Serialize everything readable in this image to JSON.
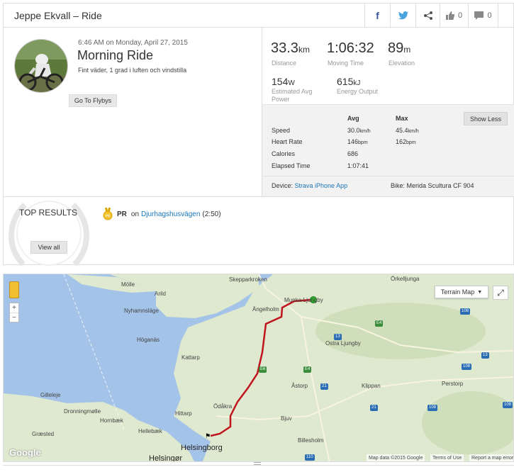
{
  "header": {
    "title": "Jeppe Ekvall – Ride",
    "likes": "0",
    "comments": "0"
  },
  "activity": {
    "date": "6:46 AM on Monday, April 27, 2015",
    "name": "Morning Ride",
    "description": "Fint väder, 1 grad i luften och vindstilla",
    "flyby_label": "Go To Flybys"
  },
  "stats": {
    "distance": {
      "value": "33.3",
      "unit": "km",
      "label": "Distance"
    },
    "moving_time": {
      "value": "1:06:32",
      "label": "Moving Time"
    },
    "elevation": {
      "value": "89",
      "unit": "m",
      "label": "Elevation"
    },
    "power": {
      "value": "154",
      "unit": "W",
      "label": "Estimated Avg Power"
    },
    "energy": {
      "value": "615",
      "unit": "kJ",
      "label": "Energy Output"
    },
    "show_less_label": "Show Less",
    "col_avg": "Avg",
    "col_max": "Max",
    "rows": [
      {
        "label": "Speed",
        "avg": "30.0",
        "avg_unit": "km/h",
        "max": "45.4",
        "max_unit": "km/h"
      },
      {
        "label": "Heart Rate",
        "avg": "146",
        "avg_unit": "bpm",
        "max": "162",
        "max_unit": "bpm"
      },
      {
        "label": "Calories",
        "avg": "686",
        "avg_unit": "",
        "max": "",
        "max_unit": ""
      },
      {
        "label": "Elapsed Time",
        "avg": "1:07:41",
        "avg_unit": "",
        "max": "",
        "max_unit": ""
      }
    ],
    "device_label": "Device:",
    "device_value": "Strava iPhone App",
    "bike": "Bike: Merida Scultura CF 904"
  },
  "results": {
    "heading": "TOP RESULTS",
    "view_all": "View all",
    "pr_badge": "PR",
    "pr_on": "on",
    "segment": "Djurhagshusvägen",
    "time": "(2:50)"
  },
  "map": {
    "type_label": "Terrain Map",
    "labels": [
      "Skepparkroken",
      "Mölle",
      "Arild",
      "Nyhamnsläge",
      "Ängelholm",
      "Munka-Ljungby",
      "Örkelljunga",
      "Höganäs",
      "Kattarp",
      "Ostra Ljungby",
      "Åstorp",
      "Klippan",
      "Perstorp",
      "Ödåkra",
      "Hittarp",
      "Bjuv",
      "Billesholm",
      "Gilleleje",
      "Dronningmølle",
      "Hornbæk",
      "Hellebæk",
      "Græsted",
      "Helsingborg",
      "Helsingør"
    ],
    "shields": [
      "E4",
      "108",
      "13",
      "E6",
      "E4",
      "21",
      "21",
      "108",
      "108",
      "13",
      "110",
      "108"
    ],
    "google": "Google",
    "attribution": [
      "Map data ©2015 Google",
      "Terms of Use",
      "Report a map error"
    ],
    "colors": {
      "route": "#c0141e",
      "water": "#a4c3e8",
      "land": "#dfe9cf",
      "start": "#2fae2f"
    }
  }
}
